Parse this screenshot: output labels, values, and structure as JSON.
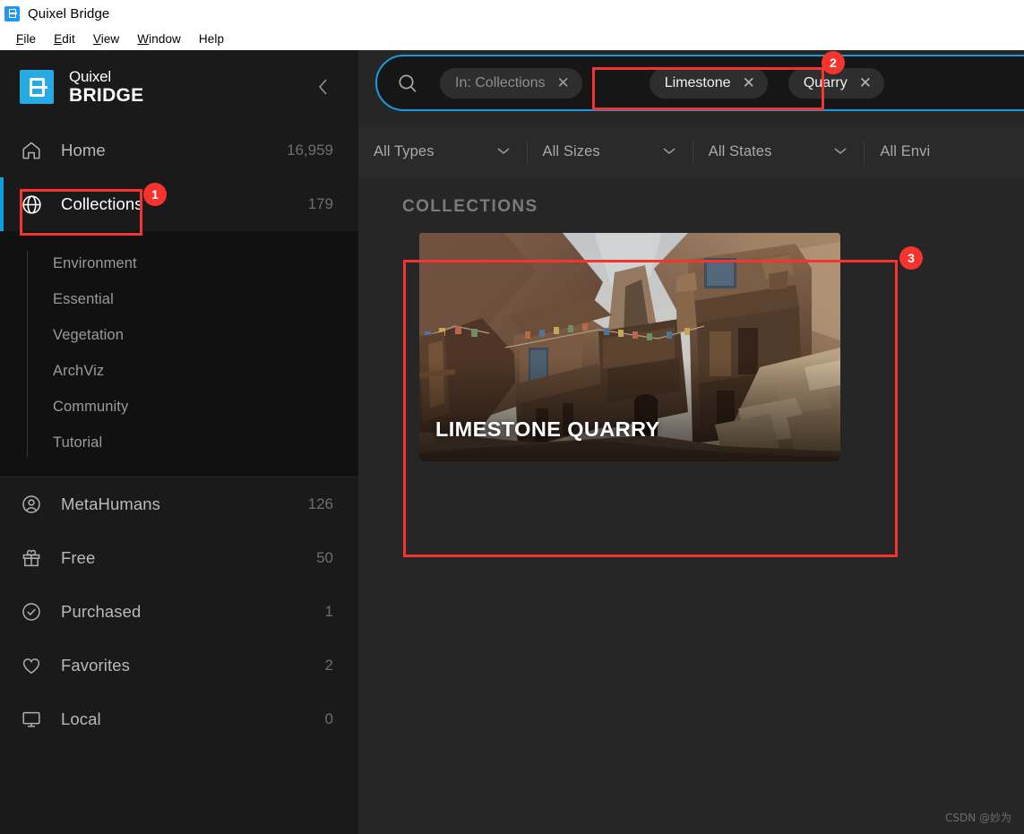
{
  "window": {
    "title": "Quixel Bridge",
    "app_icon": "bridge-app-icon",
    "menus": [
      {
        "label": "File",
        "mnemonic": "F"
      },
      {
        "label": "Edit",
        "mnemonic": "E"
      },
      {
        "label": "View",
        "mnemonic": "V"
      },
      {
        "label": "Window",
        "mnemonic": "W"
      },
      {
        "label": "Help",
        "mnemonic": "H"
      }
    ]
  },
  "sidebar": {
    "brand": {
      "line1": "Quixel",
      "line2": "BRIDGE",
      "logo_icon": "quixel-bridge-logo-icon"
    },
    "collapse_icon": "chevron-left-icon",
    "nav": [
      {
        "label": "Home",
        "count": "16,959",
        "icon": "home-icon",
        "active": false
      },
      {
        "label": "Collections",
        "count": "179",
        "icon": "globe-icon",
        "active": true
      }
    ],
    "sub_items": [
      {
        "label": "Environment"
      },
      {
        "label": "Essential"
      },
      {
        "label": "Vegetation"
      },
      {
        "label": "ArchViz"
      },
      {
        "label": "Community"
      },
      {
        "label": "Tutorial"
      }
    ],
    "nav_lower": [
      {
        "label": "MetaHumans",
        "count": "126",
        "icon": "user-circle-icon"
      },
      {
        "label": "Free",
        "count": "50",
        "icon": "gift-icon"
      },
      {
        "label": "Purchased",
        "count": "1",
        "icon": "check-circle-icon"
      },
      {
        "label": "Favorites",
        "count": "2",
        "icon": "heart-icon"
      },
      {
        "label": "Local",
        "count": "0",
        "icon": "monitor-icon"
      }
    ]
  },
  "search": {
    "icon": "search-icon",
    "scope_chip": {
      "label": "In: Collections",
      "remove_icon": "close-icon"
    },
    "term_chips": [
      {
        "label": "Limestone",
        "remove_icon": "close-icon"
      },
      {
        "label": "Quarry",
        "remove_icon": "close-icon"
      }
    ]
  },
  "filters": [
    {
      "label": "All Types",
      "chevron_icon": "chevron-down-icon"
    },
    {
      "label": "All Sizes",
      "chevron_icon": "chevron-down-icon"
    },
    {
      "label": "All States",
      "chevron_icon": "chevron-down-icon"
    },
    {
      "label": "All Envi",
      "chevron_icon": "chevron-down-icon"
    }
  ],
  "collections": {
    "section_title": "COLLECTIONS",
    "cards": [
      {
        "title": "LIMESTONE QUARRY",
        "thumbnail": "limestone-quarry-thumbnail"
      }
    ]
  },
  "annotations": [
    {
      "number": "1",
      "target": "sidebar-item-collections"
    },
    {
      "number": "2",
      "target": "search-term-chips"
    },
    {
      "number": "3",
      "target": "collections-card-limestone-quarry"
    }
  ],
  "colors": {
    "accent_blue": "#189cdf",
    "annotation_red": "#f5342e",
    "brand_blue": "#27a9e1",
    "content_bg": "#262626",
    "sidebar_bg": "#1a1a1a"
  },
  "watermark": "CSDN @妙为"
}
